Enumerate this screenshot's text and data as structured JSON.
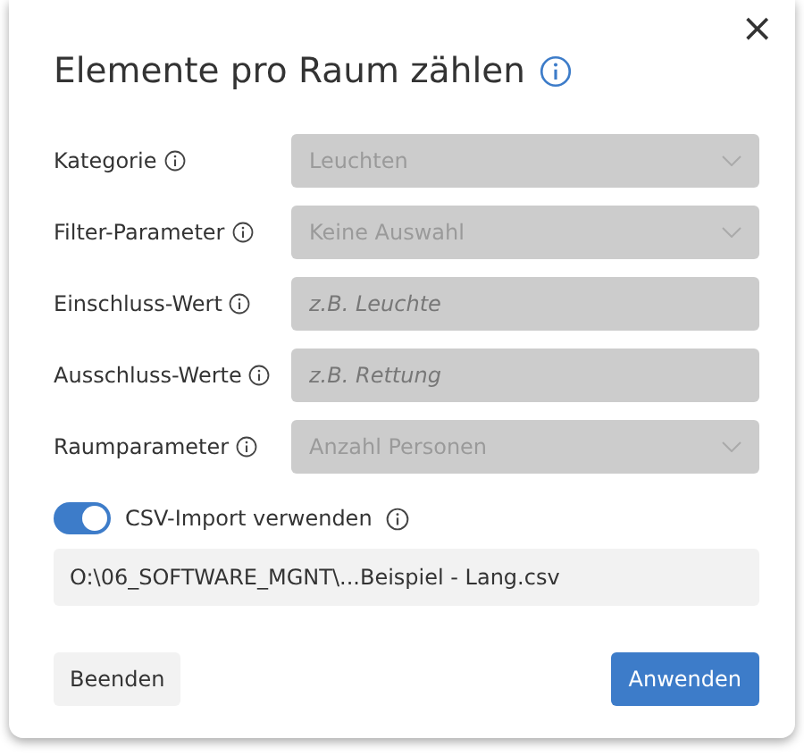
{
  "dialog": {
    "title": "Elemente pro Raum zählen",
    "close": "×"
  },
  "fields": [
    {
      "label": "Kategorie",
      "kind": "select",
      "value": "Leuchten",
      "disabled": true
    },
    {
      "label": "Filter-Parameter",
      "kind": "select",
      "value": "Keine Auswahl",
      "disabled": true
    },
    {
      "label": "Einschluss-Wert",
      "kind": "text",
      "placeholder": "z.B. Leuchte",
      "disabled": true
    },
    {
      "label": "Ausschluss-Werte",
      "kind": "text",
      "placeholder": "z.B. Rettung",
      "disabled": true
    },
    {
      "label": "Raumparameter",
      "kind": "select",
      "value": "Anzahl Personen",
      "disabled": true
    }
  ],
  "csv_toggle": {
    "label": "CSV-Import verwenden",
    "on": true
  },
  "csv_path": "O:\\06_SOFTWARE_MGNT\\...Beispiel - Lang.csv",
  "buttons": {
    "cancel": "Beenden",
    "apply": "Anwenden"
  }
}
